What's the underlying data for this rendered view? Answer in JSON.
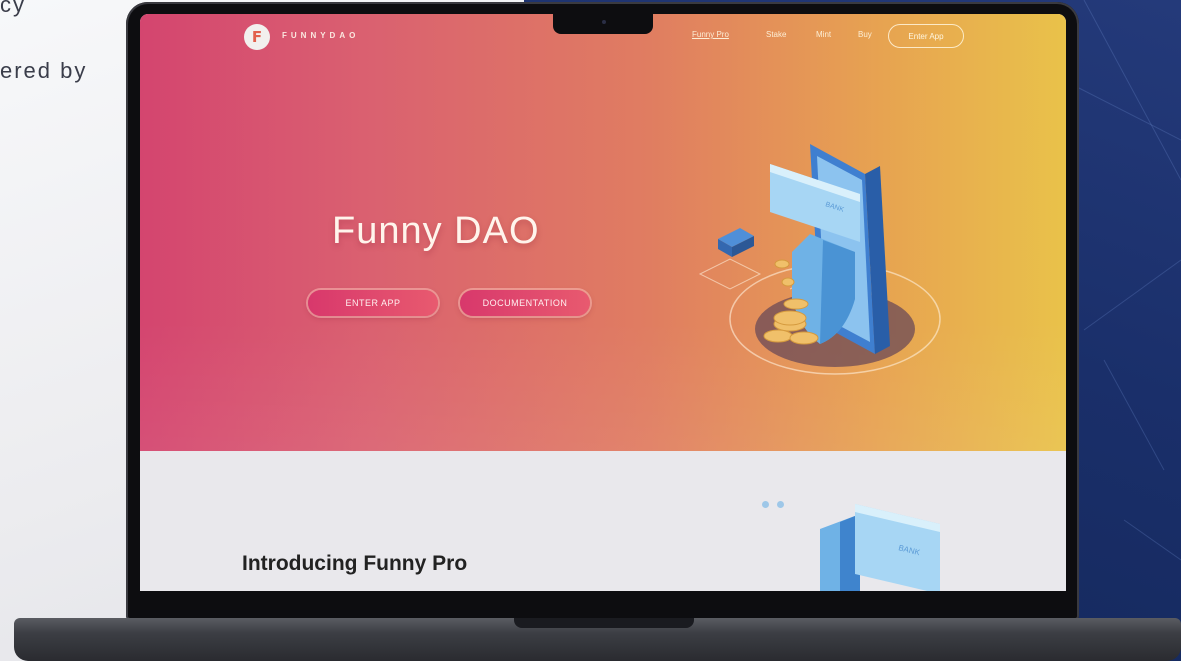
{
  "background": {
    "left_text_line1": "cy",
    "left_text_line2": "ered by"
  },
  "site": {
    "logo_mark": "F",
    "logo_text": "FUNNYDAO",
    "nav": {
      "items": [
        "Funny Pro",
        "Stake",
        "Mint",
        "Buy"
      ],
      "active": "Funny Pro",
      "enter_app": "Enter App"
    },
    "hero": {
      "title": "Funny DAO",
      "enter_app_button": "ENTER APP",
      "docs_button": "DOCUMENTATION",
      "illustration_label": "BANK"
    },
    "intro": {
      "title": "Introducing Funny Pro",
      "illustration_label": "BANK"
    }
  },
  "colors": {
    "hero_gradient_start": "#d4456f",
    "hero_gradient_end": "#e9c24a",
    "button_pink": "#d8386c",
    "backdrop_navy": "#1a2f6a"
  }
}
